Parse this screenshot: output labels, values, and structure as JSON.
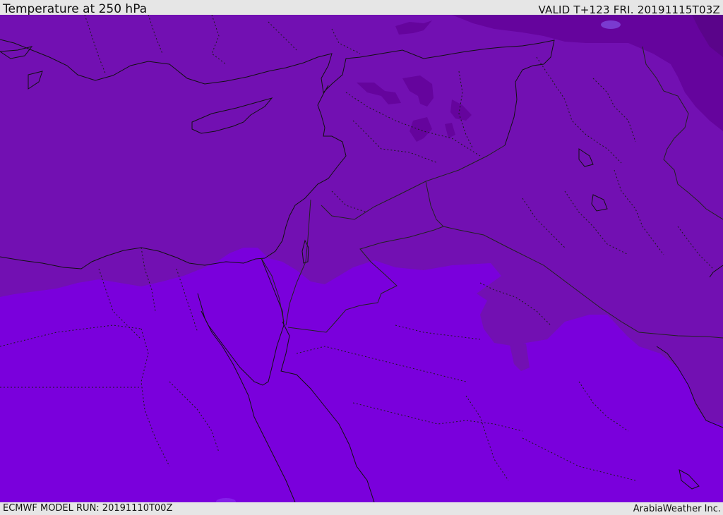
{
  "header": {
    "title": "Temperature at 250 hPa",
    "valid": "VALID T+123 FRI. 20191115T03Z"
  },
  "footer": {
    "model_run": "ECMWF MODEL RUN: 20191110T00Z",
    "credit": "ArabiaWeather Inc."
  },
  "colors": {
    "band_warm": "#7a00dc",
    "band_mid": "#7210b2",
    "band_cool": "#65049d",
    "band_cold": "#5a048a",
    "coast_line": "#111111",
    "border_line": "#222222"
  }
}
